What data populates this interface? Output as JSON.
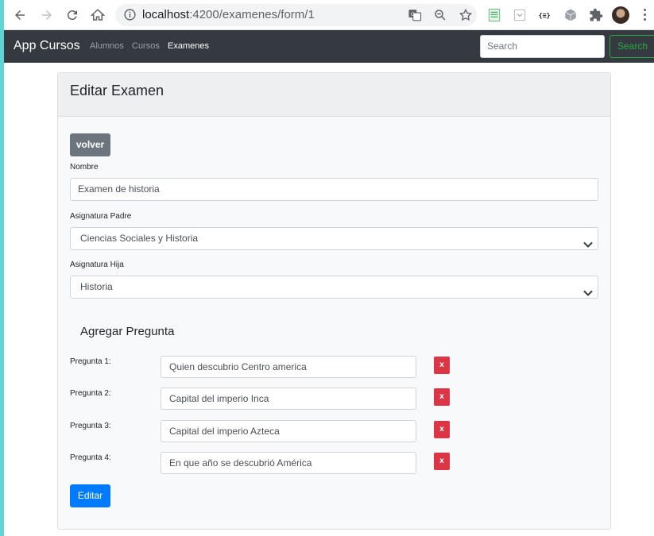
{
  "browser": {
    "url_host": "localhost",
    "url_path": ":4200/examenes/form/1"
  },
  "navbar": {
    "brand": "App Cursos",
    "links": [
      "Alumnos",
      "Cursos",
      "Examenes"
    ],
    "active_link": "Examenes",
    "search_placeholder": "Search",
    "search_button": "Search"
  },
  "card": {
    "title": "Editar Examen",
    "back_button": "volver",
    "nombre_label": "Nombre",
    "nombre_value": "Examen de historia",
    "asignatura_padre_label": "Asignatura Padre",
    "asignatura_padre_value": "Ciencias Sociales y Historia",
    "asignatura_hija_label": "Asignatura Hija",
    "asignatura_hija_value": "Historia",
    "section_title": "Agregar Pregunta",
    "preguntas": [
      {
        "label": "Pregunta 1:",
        "value": "Quien descubrio Centro america",
        "remove": "x"
      },
      {
        "label": "Pregunta 2:",
        "value": "Capital del imperio Inca",
        "remove": "x"
      },
      {
        "label": "Pregunta 3:",
        "value": "Capital del imperio Azteca",
        "remove": "x"
      },
      {
        "label": "Pregunta 4:",
        "value": "En que año se descubrió América",
        "remove": "x"
      }
    ],
    "submit_button": "Editar"
  },
  "colors": {
    "navbar_bg": "#343a40",
    "primary": "#007bff",
    "secondary": "#6c757d",
    "danger": "#dc3545",
    "success": "#28a745"
  }
}
